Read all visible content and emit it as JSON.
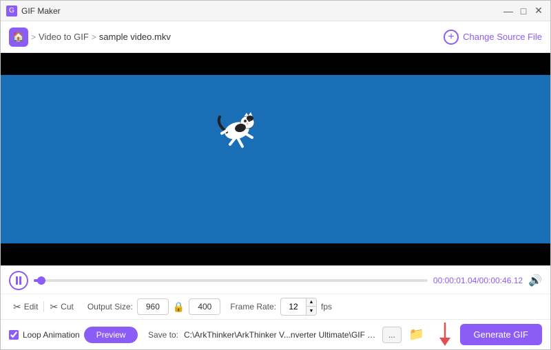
{
  "window": {
    "title": "GIF Maker",
    "minimize_label": "—",
    "maximize_label": "□",
    "close_label": "✕"
  },
  "header": {
    "home_icon": "🏠",
    "breadcrumb_separator": ">",
    "breadcrumb_section": "Video to GIF",
    "filename": "sample video.mkv",
    "change_source_label": "Change Source File"
  },
  "video": {
    "current_time": "00:00:01.04",
    "total_time": "00:00:46.12",
    "time_separator": "/",
    "progress_percent": 2
  },
  "controls": {
    "edit_label": "Edit",
    "cut_label": "Cut",
    "output_size_label": "Output Size:",
    "width": "960",
    "height": "400",
    "frame_rate_label": "Frame Rate:",
    "fps_value": "12",
    "fps_unit": "fps"
  },
  "loop_animation": {
    "label": "Loop Animation",
    "checked": true
  },
  "preview_btn": {
    "label": "Preview"
  },
  "save": {
    "label": "Save to:",
    "path": "C:\\ArkThinker\\ArkThinker V...nverter Ultimate\\GIF Maker",
    "dots_label": "...",
    "folder_icon": "📁"
  },
  "generate_btn": {
    "label": "Generate GIF"
  }
}
